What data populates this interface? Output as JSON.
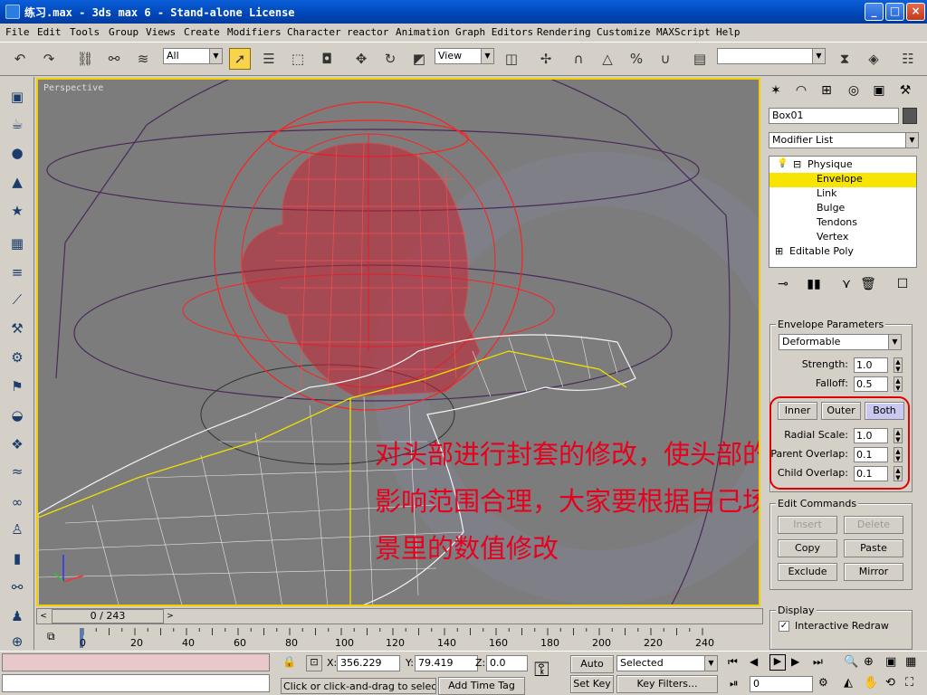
{
  "window": {
    "title": "练习.max - 3ds max 6 - Stand-alone License",
    "controls": {
      "minimize": "_",
      "maximize": "□",
      "close": "×"
    }
  },
  "menu": [
    "File",
    "Edit",
    "Tools",
    "Group",
    "Views",
    "Create",
    "Modifiers",
    "Character",
    "reactor",
    "Animation",
    "Graph Editors",
    "Rendering",
    "Customize",
    "MAXScript",
    "Help"
  ],
  "toolbar": {
    "selection_filter": "All",
    "reference_coord": "View",
    "named_selection": ""
  },
  "viewport": {
    "label": "Perspective",
    "caption": "对头部进行封套的修改，使头部的影响范围合理，大家要根据自己场景里的数值修改"
  },
  "command_panel": {
    "object_name": "Box01",
    "modifier_list": "Modifier List",
    "stack": [
      {
        "label": "Physique",
        "level": 0,
        "expanded": true
      },
      {
        "label": "Envelope",
        "level": 1,
        "selected": true
      },
      {
        "label": "Link",
        "level": 1
      },
      {
        "label": "Bulge",
        "level": 1
      },
      {
        "label": "Tendons",
        "level": 1
      },
      {
        "label": "Vertex",
        "level": 1
      },
      {
        "label": "Editable Poly",
        "level": 0,
        "expanded": false
      }
    ],
    "envelope_parameters": {
      "title": "Envelope Parameters",
      "type": "Deformable",
      "strength_label": "Strength:",
      "strength": "1.0",
      "falloff_label": "Falloff:",
      "falloff": "0.5",
      "tabs": [
        "Inner",
        "Outer",
        "Both"
      ],
      "active_tab": "Both",
      "radial_scale_label": "Radial Scale:",
      "radial_scale": "1.0",
      "parent_overlap_label": "Parent Overlap:",
      "parent_overlap": "0.1",
      "child_overlap_label": "Child Overlap:",
      "child_overlap": "0.1"
    },
    "edit_commands": {
      "title": "Edit Commands",
      "insert": "Insert",
      "delete": "Delete",
      "copy": "Copy",
      "paste": "Paste",
      "exclude": "Exclude",
      "mirror": "Mirror"
    },
    "display": {
      "title": "Display",
      "interactive_redraw": "Interactive Redraw",
      "interactive_redraw_checked": true
    }
  },
  "timeline": {
    "frame_display": "0 / 243",
    "ticks": [
      "0",
      "20",
      "40",
      "60",
      "80",
      "100",
      "120",
      "140",
      "160",
      "180",
      "200",
      "220",
      "240"
    ]
  },
  "status": {
    "x_label": "X:",
    "x": "356.229",
    "y_label": "Y:",
    "y": "79.419",
    "z_label": "Z:",
    "z": "0.0",
    "prompt": "Click or click-and-drag to select obj",
    "add_time_tag": "Add Time Tag",
    "auto_key": "Auto Key",
    "set_key": "Set Key",
    "key_mode": "Selected",
    "key_filters": "Key Filters...",
    "current_frame": "0"
  },
  "colors": {
    "selection_yellow": "#f7e400",
    "wire_red": "#ff2020",
    "caption_red": "#e8001c",
    "highlight_red": "#e00000"
  }
}
